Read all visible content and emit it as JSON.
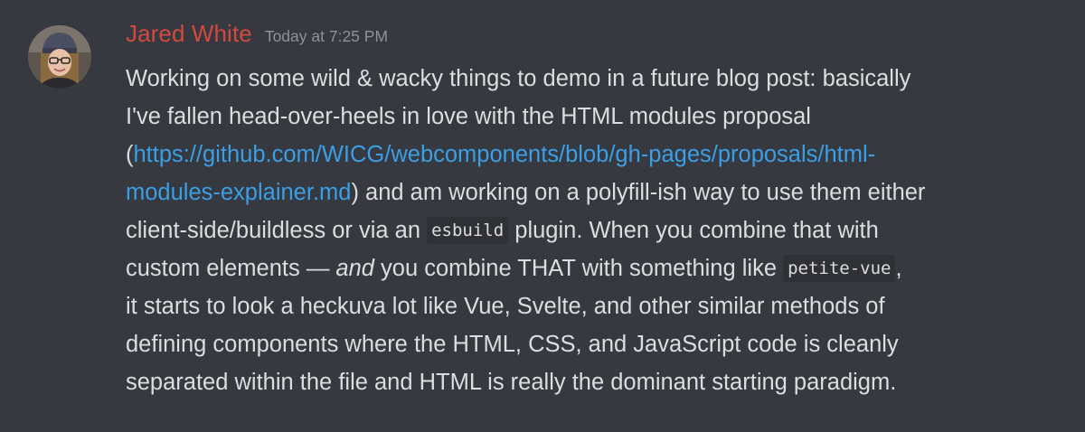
{
  "message": {
    "author": "Jared White",
    "timestamp": "Today at 7:25 PM",
    "avatar_icon": "user-avatar-photo",
    "colors": {
      "background": "#36393f",
      "username": "#d4493d",
      "timestamp": "#8e9297",
      "text": "#dcddde",
      "link": "#3b9fe6",
      "code_background": "#2f3136"
    },
    "lines": [
      {
        "text": "Working on some wild & wacky things to demo in a future blog post: basically"
      },
      {
        "text": "I've fallen head-over-heels in love with the HTML modules proposal"
      },
      {
        "pre": "(",
        "link": "https://github.com/WICG/webcomponents/blob/gh-pages/proposals/html-"
      },
      {
        "link": "modules-explainer.md",
        "post": ") and am working on a polyfill-ish way to use them either"
      },
      {
        "pre": "client-side/buildless or via an ",
        "code": "esbuild",
        "post": " plugin. When you combine that with"
      },
      {
        "pre": "custom elements — ",
        "em": "and",
        "mid": " you combine THAT with something like ",
        "code": "petite-vue",
        "post": ","
      },
      {
        "text": "it starts to look a heckuva lot like Vue, Svelte, and other similar methods of"
      },
      {
        "text": "defining components where the HTML, CSS, and JavaScript code is cleanly"
      },
      {
        "text": "separated within the file and HTML is really the dominant starting paradigm."
      }
    ]
  }
}
